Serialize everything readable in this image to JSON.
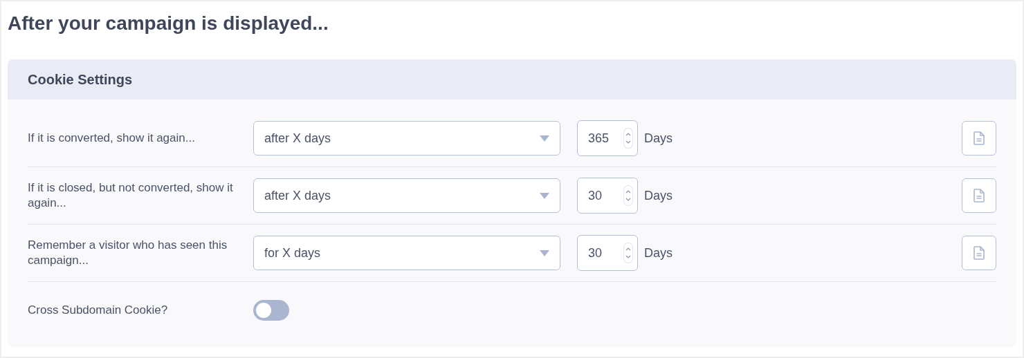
{
  "title": "After your campaign is displayed...",
  "section": {
    "title": "Cookie Settings",
    "rows": [
      {
        "label": "If it is converted, show it again...",
        "select": "after X days",
        "number": "365",
        "unit": "Days"
      },
      {
        "label": "If it is closed, but not converted, show it again...",
        "select": "after X days",
        "number": "30",
        "unit": "Days"
      },
      {
        "label": "Remember a visitor who has seen this campaign...",
        "select": "for X days",
        "number": "30",
        "unit": "Days"
      }
    ],
    "toggle": {
      "label": "Cross Subdomain Cookie?",
      "on": false
    }
  }
}
